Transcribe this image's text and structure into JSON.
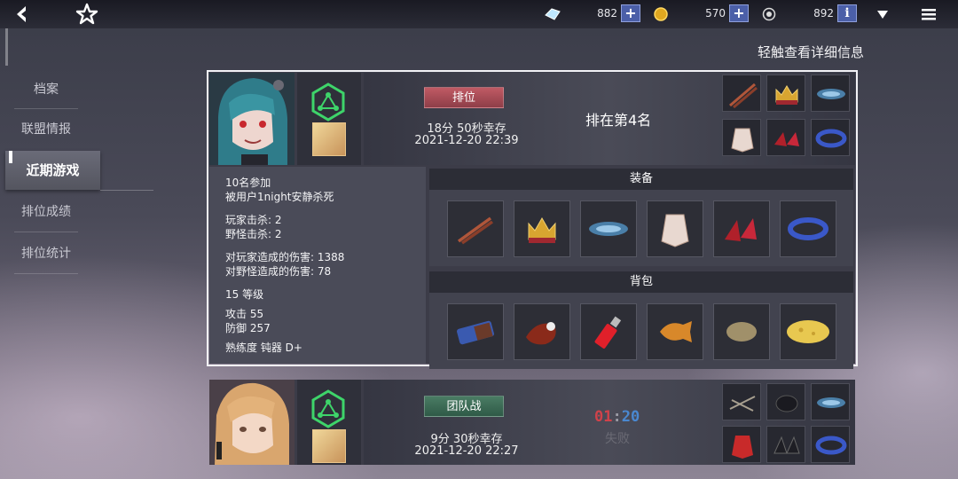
{
  "topbar": {
    "currencies": [
      {
        "icon": "crystal-icon",
        "value": "882"
      },
      {
        "icon": "gold-coin-icon",
        "value": "570"
      },
      {
        "icon": "token-icon",
        "value": "892"
      }
    ],
    "info_label": "i"
  },
  "hint": "轻触查看详细信息",
  "sidebar": {
    "items": [
      {
        "label": "档案"
      },
      {
        "label": "联盟情报"
      },
      {
        "label": "近期游戏"
      },
      {
        "label": "排位成绩"
      },
      {
        "label": "排位统计"
      }
    ],
    "active_index": 2
  },
  "matches": [
    {
      "mode": "排位",
      "survival": "18分 50秒幸存",
      "datetime": "2021-12-20 22:39",
      "result": "排在第4名",
      "stats": {
        "participants": "10名参加",
        "killed_by": "被用户1night安静杀死",
        "player_kills": "玩家击杀: 2",
        "monster_kills": "野怪击杀: 2",
        "player_damage": "对玩家造成的伤害: 1388",
        "monster_damage": "对野怪造成的伤害: 78",
        "level": "15 等级",
        "attack": "攻击 55",
        "defense": "防御 257",
        "proficiency": "熟练度  钝器 D+"
      },
      "equipment_title": "装备",
      "equipment": [
        "chopsticks-icon",
        "crown-icon",
        "fish-bone-icon",
        "armor-icon",
        "red-heels-icon",
        "galaxy-bracelet-icon"
      ],
      "backpack_title": "背包",
      "backpack": [
        "chocolate-bar-icon",
        "meat-icon",
        "lighter-icon",
        "taiyaki-icon",
        "potato-icon",
        "cheese-icon"
      ]
    },
    {
      "mode": "团队战",
      "survival": "9分 30秒幸存",
      "datetime": "2021-12-20 22:27",
      "timer_red": "01",
      "timer_sep": ":",
      "timer_blue": "20",
      "result": "失败",
      "equipment": [
        "chain-icon",
        "dark-helmet-icon",
        "fish-bone-icon",
        "red-armor-icon",
        "dark-boots-icon",
        "galaxy-bracelet-icon"
      ]
    }
  ]
}
